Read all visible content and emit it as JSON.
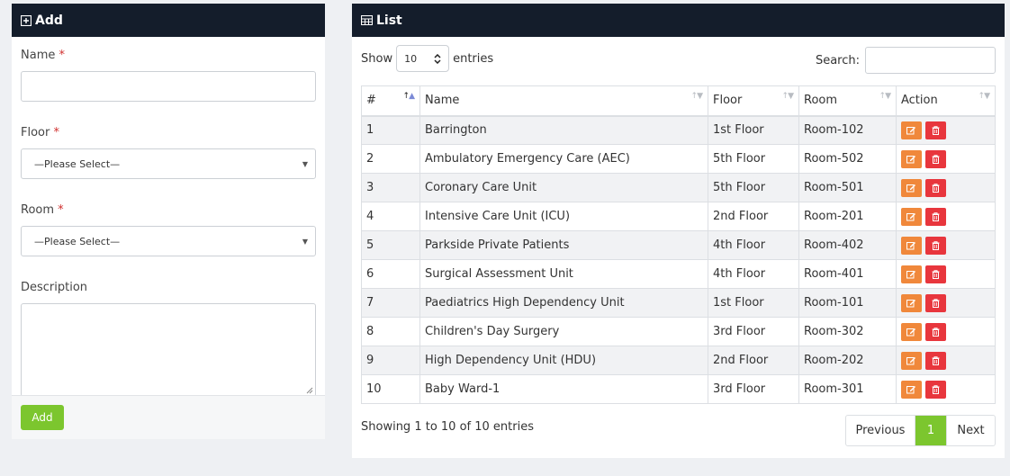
{
  "add_panel": {
    "title": "Add",
    "fields": {
      "name_label": "Name",
      "floor_label": "Floor",
      "floor_value": "—Please Select—",
      "room_label": "Room",
      "room_value": "—Please Select—",
      "description_label": "Description",
      "required_mark": "*"
    },
    "submit_label": "Add"
  },
  "list_panel": {
    "title": "List",
    "show_label": "Show",
    "entries_value": "10",
    "entries_label": "entries",
    "search_label": "Search:",
    "columns": [
      "#",
      "Name",
      "Floor",
      "Room",
      "Action"
    ],
    "rows": [
      {
        "no": "1",
        "name": "Barrington",
        "floor": "1st Floor",
        "room": "Room-102"
      },
      {
        "no": "2",
        "name": "Ambulatory Emergency Care (AEC)",
        "floor": "5th Floor",
        "room": "Room-502"
      },
      {
        "no": "3",
        "name": "Coronary Care Unit",
        "floor": "5th Floor",
        "room": "Room-501"
      },
      {
        "no": "4",
        "name": "Intensive Care Unit (ICU)",
        "floor": "2nd Floor",
        "room": "Room-201"
      },
      {
        "no": "5",
        "name": "Parkside Private Patients",
        "floor": "4th Floor",
        "room": "Room-402"
      },
      {
        "no": "6",
        "name": "Surgical Assessment Unit",
        "floor": "4th Floor",
        "room": "Room-401"
      },
      {
        "no": "7",
        "name": "Paediatrics High Dependency Unit",
        "floor": "1st Floor",
        "room": "Room-101"
      },
      {
        "no": "8",
        "name": "Children's Day Surgery",
        "floor": "3rd Floor",
        "room": "Room-302"
      },
      {
        "no": "9",
        "name": "High Dependency Unit (HDU)",
        "floor": "2nd Floor",
        "room": "Room-202"
      },
      {
        "no": "10",
        "name": "Baby Ward-1",
        "floor": "3rd Floor",
        "room": "Room-301"
      }
    ],
    "info": "Showing 1 to 10 of 10 entries",
    "pagination": {
      "previous": "Previous",
      "current": "1",
      "next": "Next"
    }
  },
  "colors": {
    "header_bg": "#141d2b",
    "accent_green": "#7cc62e",
    "edit_orange": "#f0883b",
    "delete_red": "#e8363d"
  },
  "icons": [
    "plus-square-icon",
    "table-icon",
    "sort-icon",
    "edit-icon",
    "trash-icon",
    "chevron-updown-icon",
    "caret-down-icon"
  ]
}
